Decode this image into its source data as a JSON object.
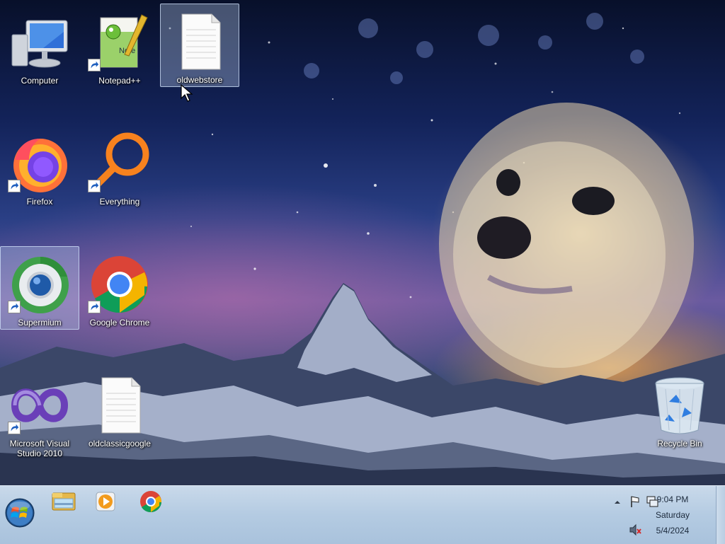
{
  "desktop": {
    "icons": [
      {
        "label": "Computer",
        "icon": "computer-icon",
        "shortcut": false,
        "selected": false
      },
      {
        "label": "Notepad++",
        "icon": "notepad-plus-plus-icon",
        "shortcut": true,
        "selected": false
      },
      {
        "label": "oldwebstore",
        "icon": "text-document-icon",
        "shortcut": false,
        "selected": true
      },
      {
        "label": "Firefox",
        "icon": "firefox-icon",
        "shortcut": true,
        "selected": false
      },
      {
        "label": "Everything",
        "icon": "everything-search-icon",
        "shortcut": true,
        "selected": false
      },
      {
        "label": "Supermium",
        "icon": "supermium-icon",
        "shortcut": true,
        "selected": true
      },
      {
        "label": "Google Chrome",
        "icon": "chrome-icon",
        "shortcut": true,
        "selected": false
      },
      {
        "label": "Microsoft Visual\nStudio 2010",
        "label_line1": "Microsoft Visual",
        "label_line2": "Studio 2010",
        "icon": "visual-studio-icon",
        "shortcut": true,
        "selected": false
      },
      {
        "label": "oldclassicgoogle",
        "icon": "text-document-icon",
        "shortcut": false,
        "selected": false
      },
      {
        "label": "Recycle Bin",
        "icon": "recycle-bin-icon",
        "shortcut": false,
        "selected": false
      }
    ]
  },
  "taskbar": {
    "start": {
      "icon": "windows-start-orb-icon"
    },
    "pinned": [
      {
        "icon": "file-explorer-icon",
        "name": "Windows Explorer"
      },
      {
        "icon": "media-player-icon",
        "name": "Windows Media Player"
      },
      {
        "icon": "chrome-icon",
        "name": "Google Chrome"
      }
    ],
    "tray": {
      "icons": [
        "show-hidden-icons-chevron-icon",
        "action-center-flag-icon",
        "network-icon",
        "volume-muted-icon"
      ],
      "time": "9:04 PM",
      "day": "Saturday",
      "date": "5/4/2024"
    }
  },
  "colors": {
    "taskbar": "#b4cbe2",
    "selection": "#bed2f0",
    "label_text": "#ffffff"
  }
}
